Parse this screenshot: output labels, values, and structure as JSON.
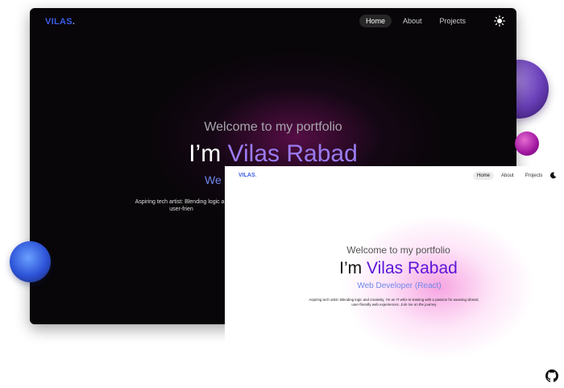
{
  "dark_window": {
    "logo": "VILAS",
    "logo_dot": ".",
    "nav": {
      "home": "Home",
      "about": "About",
      "projects": "Projects"
    },
    "theme_toggle_icon": "sun-icon",
    "welcome": "Welcome to my portfolio",
    "hero_prefix": "I’m ",
    "hero_name": "Vilas Rabad",
    "role": "We",
    "bio_line1": "Aspiring tech artist: Blending logic an",
    "bio_line2": "user-frien"
  },
  "light_window": {
    "logo": "VILAS",
    "logo_dot": ".",
    "nav": {
      "home": "Home",
      "about": "About",
      "projects": "Projects"
    },
    "theme_toggle_icon": "moon-icon",
    "welcome": "Welcome to my portfolio",
    "hero_prefix": "I’m ",
    "hero_name": "Vilas Rabad",
    "role": "Web Developer (React)",
    "bio_line1": "Aspiring tech artist: Blending logic and creativity, I'm an IT whiz-in-training with a passion for weaving vibrant,",
    "bio_line2": "user-friendly web experiences. Join me on the journey"
  },
  "footer_icon": "github-icon",
  "colors": {
    "logo": "#3a5de6",
    "hero_name_dark": "#9b7bf2",
    "hero_name_light": "#5c14d9",
    "role": "#6f87ea"
  }
}
